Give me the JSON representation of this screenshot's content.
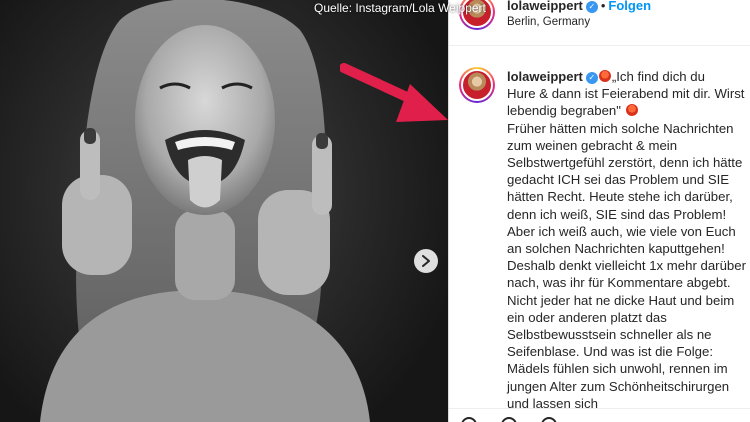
{
  "source_credit": "Quelle: Instagram/Lola Weippert",
  "post": {
    "username": "lolaweippert",
    "follow_label": "Folgen",
    "separator": "•",
    "location": "Berlin, Germany",
    "verified_mark": "✓",
    "caption_quote_line1": "„Ich find dich du",
    "caption_quote_rest": "Hure & dann ist Feierabend mit dir. Wirst lebendig begraben\"",
    "caption_body": "Früher hätten mich solche Nachrichten zum weinen gebracht & mein Selbstwertgefühl zerstört, denn ich hätte gedacht ICH sei das Problem und SIE hätten Recht. Heute stehe ich darüber, denn ich weiß, SIE sind das Problem! Aber ich weiß auch, wie viele von Euch an solchen Nachrichten kaputtgehen! Deshalb denkt vielleicht 1x mehr darüber nach, was ihr für Kommentare abgebt. Nicht jeder hat ne dicke Haut und beim ein oder anderen platzt das Selbstbewusstsein schneller als ne Seifenblase. Und was ist die Folge: Mädels fühlen sich unwohl, rennen im jungen Alter zum Schönheitschirurgen und lassen sich"
  },
  "icons": {
    "next": "chevron-right-icon",
    "verified": "verified-badge-icon",
    "emoji": "angry-face-emoji-icon",
    "arrow": "red-arrow-icon"
  },
  "colors": {
    "accent_blue": "#0095f6",
    "verified_blue": "#3897f0",
    "arrow_red": "#e0204a",
    "text": "#262626"
  }
}
